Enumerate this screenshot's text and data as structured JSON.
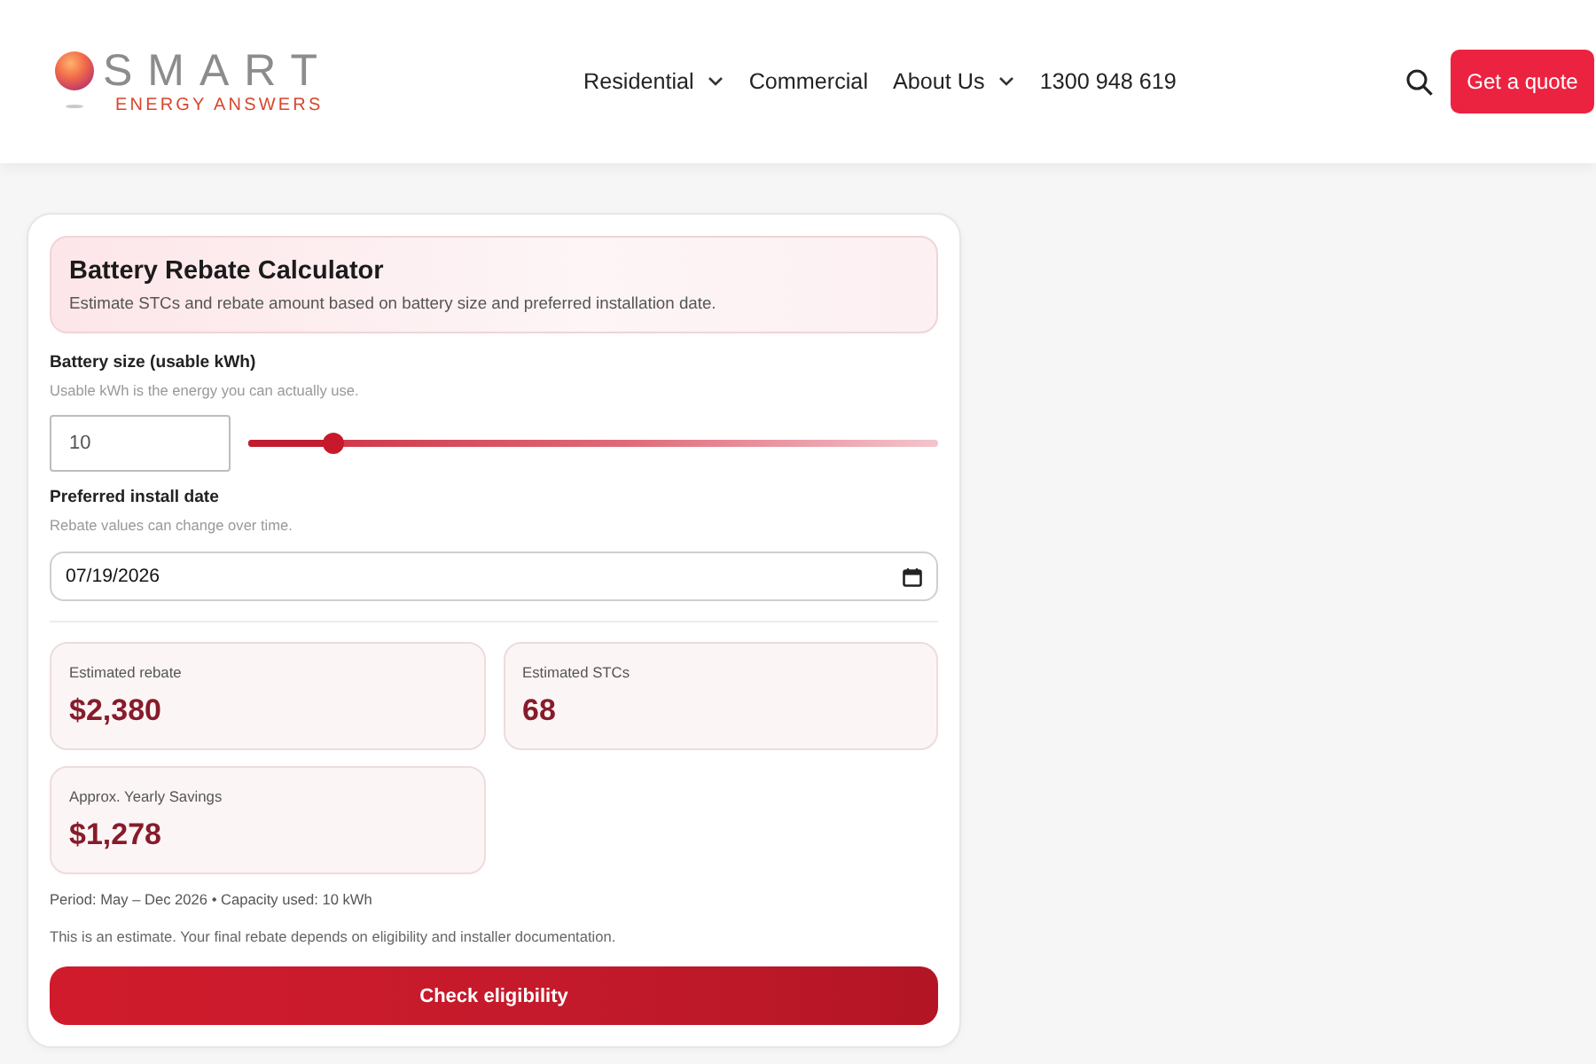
{
  "header": {
    "logo": {
      "wordmark": "SMART",
      "tagline": "ENERGY ANSWERS"
    },
    "nav": [
      {
        "label": "Residential",
        "has_menu": true
      },
      {
        "label": "Commercial",
        "has_menu": false
      },
      {
        "label": "About Us",
        "has_menu": true
      },
      {
        "label": "1300 948 619",
        "has_menu": false
      }
    ],
    "cta": "Get a quote"
  },
  "calculator": {
    "title": "Battery Rebate Calculator",
    "subtitle": "Estimate STCs and rebate amount based on battery size and preferred installation date.",
    "battery_size": {
      "label": "Battery size (usable kWh)",
      "hint": "Usable kWh is the energy you can actually use.",
      "value": "10",
      "level": 0.124
    },
    "install_date": {
      "label": "Preferred install date",
      "hint": "Rebate values can change over time.",
      "value": "07/19/2026"
    },
    "results": [
      {
        "label": "Estimated rebate",
        "value": "$2,380"
      },
      {
        "label": "Estimated STCs",
        "value": "68"
      },
      {
        "label": "Approx. Yearly Savings",
        "value": "$1,278"
      }
    ],
    "period_note": "Period: May – Dec 2026 • Capacity used: 10 kWh",
    "disclaimer": "This is an estimate. Your final rebate depends on eligibility and installer documentation.",
    "button": "Check eligibility"
  }
}
